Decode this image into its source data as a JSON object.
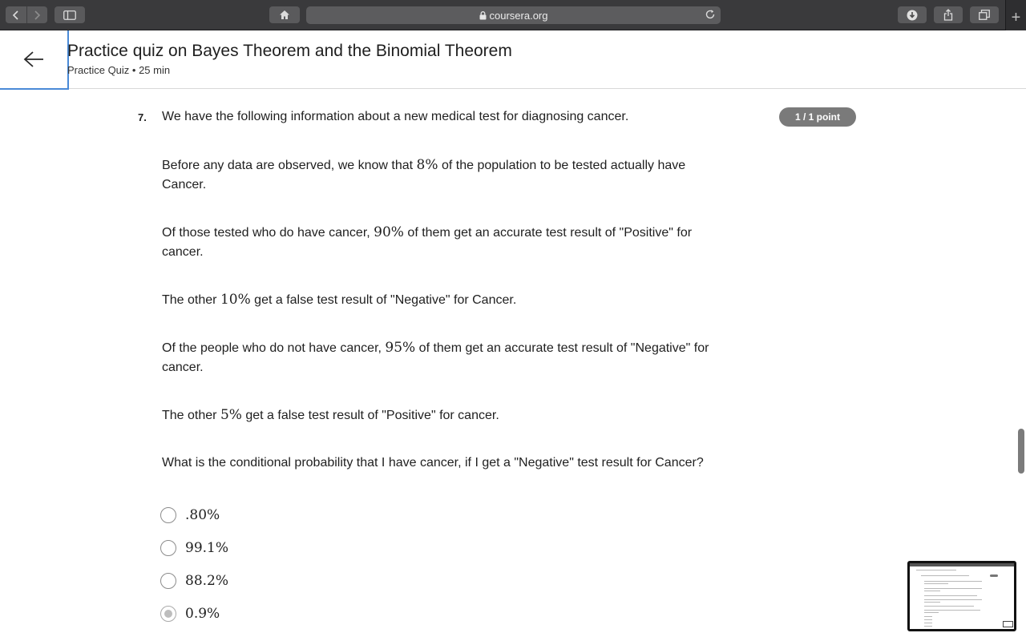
{
  "browser": {
    "url": "coursera.org",
    "icons": {
      "back": "chevron-left-icon",
      "forward": "chevron-right-icon",
      "sidebar": "sidebar-icon",
      "home": "home-icon",
      "lock": "lock-icon",
      "reload": "reload-icon",
      "download": "download-icon",
      "share": "share-icon",
      "tabs": "tabs-icon",
      "new_tab": "plus-icon"
    }
  },
  "header": {
    "back_icon": "arrow-left-icon",
    "title": "Practice quiz on Bayes Theorem and the Binomial Theorem",
    "subtitle": "Practice Quiz • 25 min"
  },
  "question": {
    "number": "7.",
    "points": "1 / 1 point",
    "intro": "We have the following information about a new medical test for diagnosing cancer.",
    "paragraphs": [
      {
        "before": "Before any data are observed, we know that ",
        "math": "8%",
        "after": " of the population to be tested actually have Cancer."
      },
      {
        "before": "Of those tested who do have cancer, ",
        "math": "90%",
        "after": " of them get an accurate test result of \"Positive\" for cancer."
      },
      {
        "before": "The other ",
        "math": "10%",
        "after": " get a false test result of \"Negative\" for Cancer."
      },
      {
        "before": "Of the people who do not have cancer, ",
        "math": "95%",
        "after": " of them get an accurate test result of \"Negative\" for cancer."
      },
      {
        "before": "The other ",
        "math": "5%",
        "after": " get a false test result of \"Positive\" for cancer."
      }
    ],
    "prompt": "What is the conditional probability that I have cancer, if I get a \"Negative\" test result for Cancer?",
    "options": [
      {
        "label": ".80%",
        "selected": false
      },
      {
        "label": "99.1%",
        "selected": false
      },
      {
        "label": "88.2%",
        "selected": false
      },
      {
        "label": "0.9%",
        "selected": true
      }
    ]
  },
  "colors": {
    "points_badge": "#7a7a7a",
    "focus_outline": "#4a8ad7",
    "chrome_bg": "#3a3a3c"
  }
}
